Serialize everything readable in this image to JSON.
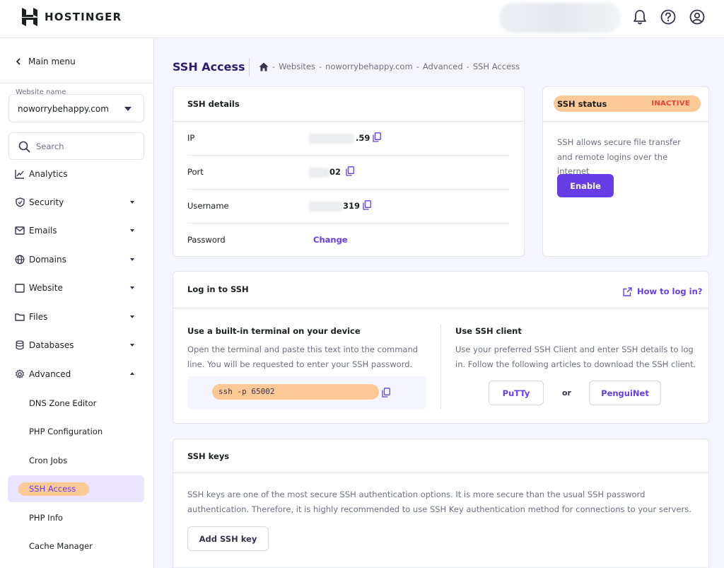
{
  "header": {
    "brand": "HOSTINGER"
  },
  "sidebar": {
    "main_menu": "Main menu",
    "website_label": "Website name",
    "website_value": "noworrybehappy.com",
    "search_placeholder": "Search",
    "items": [
      {
        "label": "Analytics"
      },
      {
        "label": "Security"
      },
      {
        "label": "Emails"
      },
      {
        "label": "Domains"
      },
      {
        "label": "Website"
      },
      {
        "label": "Files"
      },
      {
        "label": "Databases"
      },
      {
        "label": "Advanced"
      }
    ],
    "sub_items": [
      {
        "label": "DNS Zone Editor"
      },
      {
        "label": "PHP Configuration"
      },
      {
        "label": "Cron Jobs"
      },
      {
        "label": "SSH Access"
      },
      {
        "label": "PHP Info"
      },
      {
        "label": "Cache Manager"
      }
    ]
  },
  "main": {
    "title": "SSH Access",
    "breadcrumb": [
      "Websites",
      "noworrybehappy.com",
      "Advanced",
      "SSH Access"
    ],
    "breadcrumb_sep": "-",
    "ssh_details": {
      "title": "SSH details",
      "rows": [
        {
          "label": "IP",
          "value": ".59"
        },
        {
          "label": "Port",
          "value": "02"
        },
        {
          "label": "Username",
          "value": "319"
        },
        {
          "label": "Password",
          "value": "Change"
        }
      ]
    },
    "ssh_status": {
      "title": "SSH status",
      "badge": "INACTIVE",
      "description": "SSH allows secure file transfer and remote logins over the internet",
      "button": "Enable"
    },
    "login": {
      "title": "Log in to SSH",
      "help_link": "How to log in?",
      "terminal_heading": "Use a built-in terminal on your device",
      "terminal_desc": "Open the terminal and paste this text into the command line. You will be requested to enter your SSH password.",
      "command": "ssh -p 65002",
      "client_heading": "Use SSH client",
      "client_desc": "Use your preferred SSH Client and enter SSH details to log in. Follow the following articles to download the SSH client.",
      "client_a": "PuTTy",
      "or": "or",
      "client_b": "PenguiNet"
    },
    "keys": {
      "title": "SSH keys",
      "description": "SSH keys are one of the most secure SSH authentication options. It is more secure than the usual SSH password authentication. Therefore, it is highly recommended to use SSH Key authentication method for connections to your servers.",
      "button": "Add SSH key"
    }
  },
  "colors": {
    "accent": "#673de6",
    "highlight": "#fbc996",
    "inactive": "#e0453e",
    "text_dark": "#1d1e20"
  }
}
